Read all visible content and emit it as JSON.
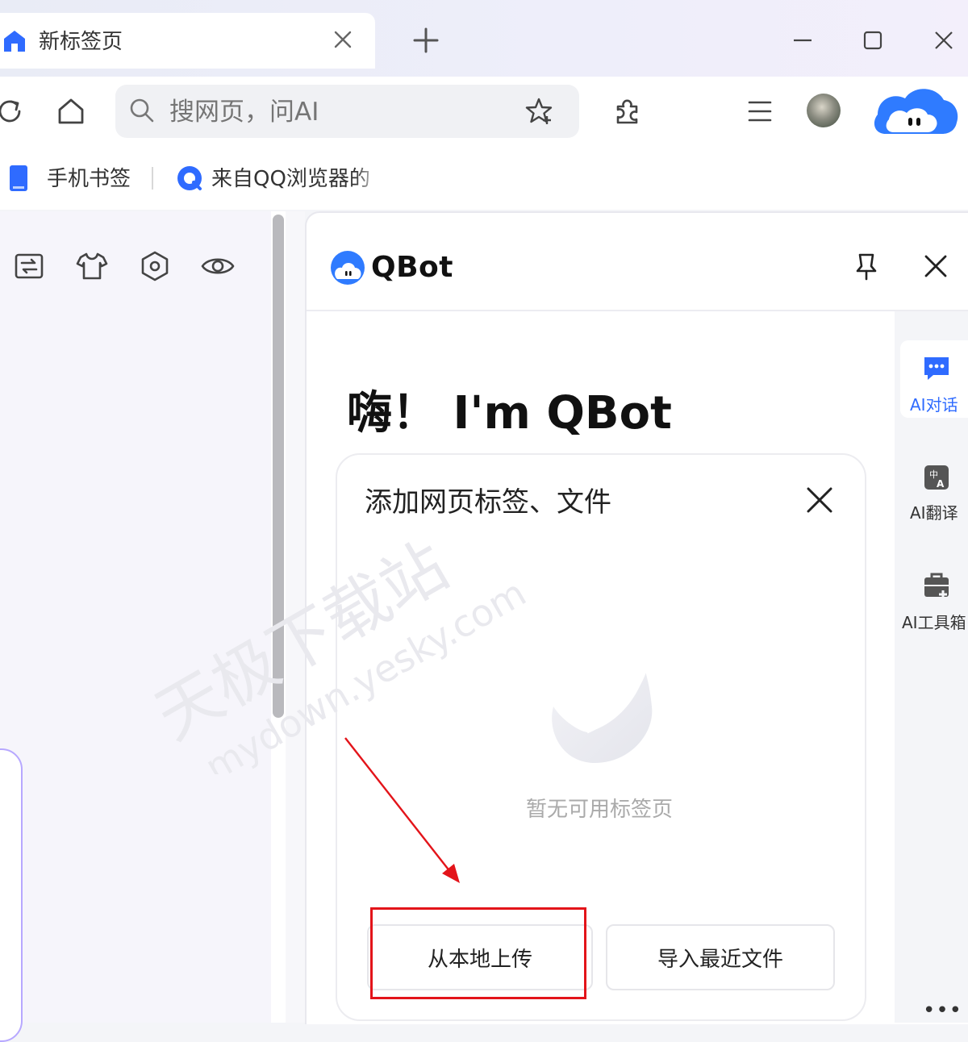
{
  "tab": {
    "title": "新标签页"
  },
  "toolbar": {
    "search_placeholder": "搜网页，问AI"
  },
  "bookmarks": [
    {
      "label": "手机书签"
    },
    {
      "label": "来自QQ浏览器的"
    }
  ],
  "panel": {
    "title": "QBot",
    "greeting": "嗨！ I'm QBot",
    "card": {
      "title": "添加网页标签、文件",
      "empty_text": "暂无可用标签页",
      "upload_label": "从本地上传",
      "recent_label": "导入最近文件"
    }
  },
  "rail": [
    {
      "label": "AI对话",
      "icon": "chat-icon",
      "active": true
    },
    {
      "label": "AI翻译",
      "icon": "translate-icon",
      "active": false
    },
    {
      "label": "AI工具箱",
      "icon": "toolbox-icon",
      "active": false
    }
  ],
  "rail_more": "•••",
  "watermark": {
    "line1": "天极下载站",
    "line2": "mydown.yesky.com"
  },
  "colors": {
    "accent": "#2f6bff",
    "annotation": "#e3141a"
  }
}
